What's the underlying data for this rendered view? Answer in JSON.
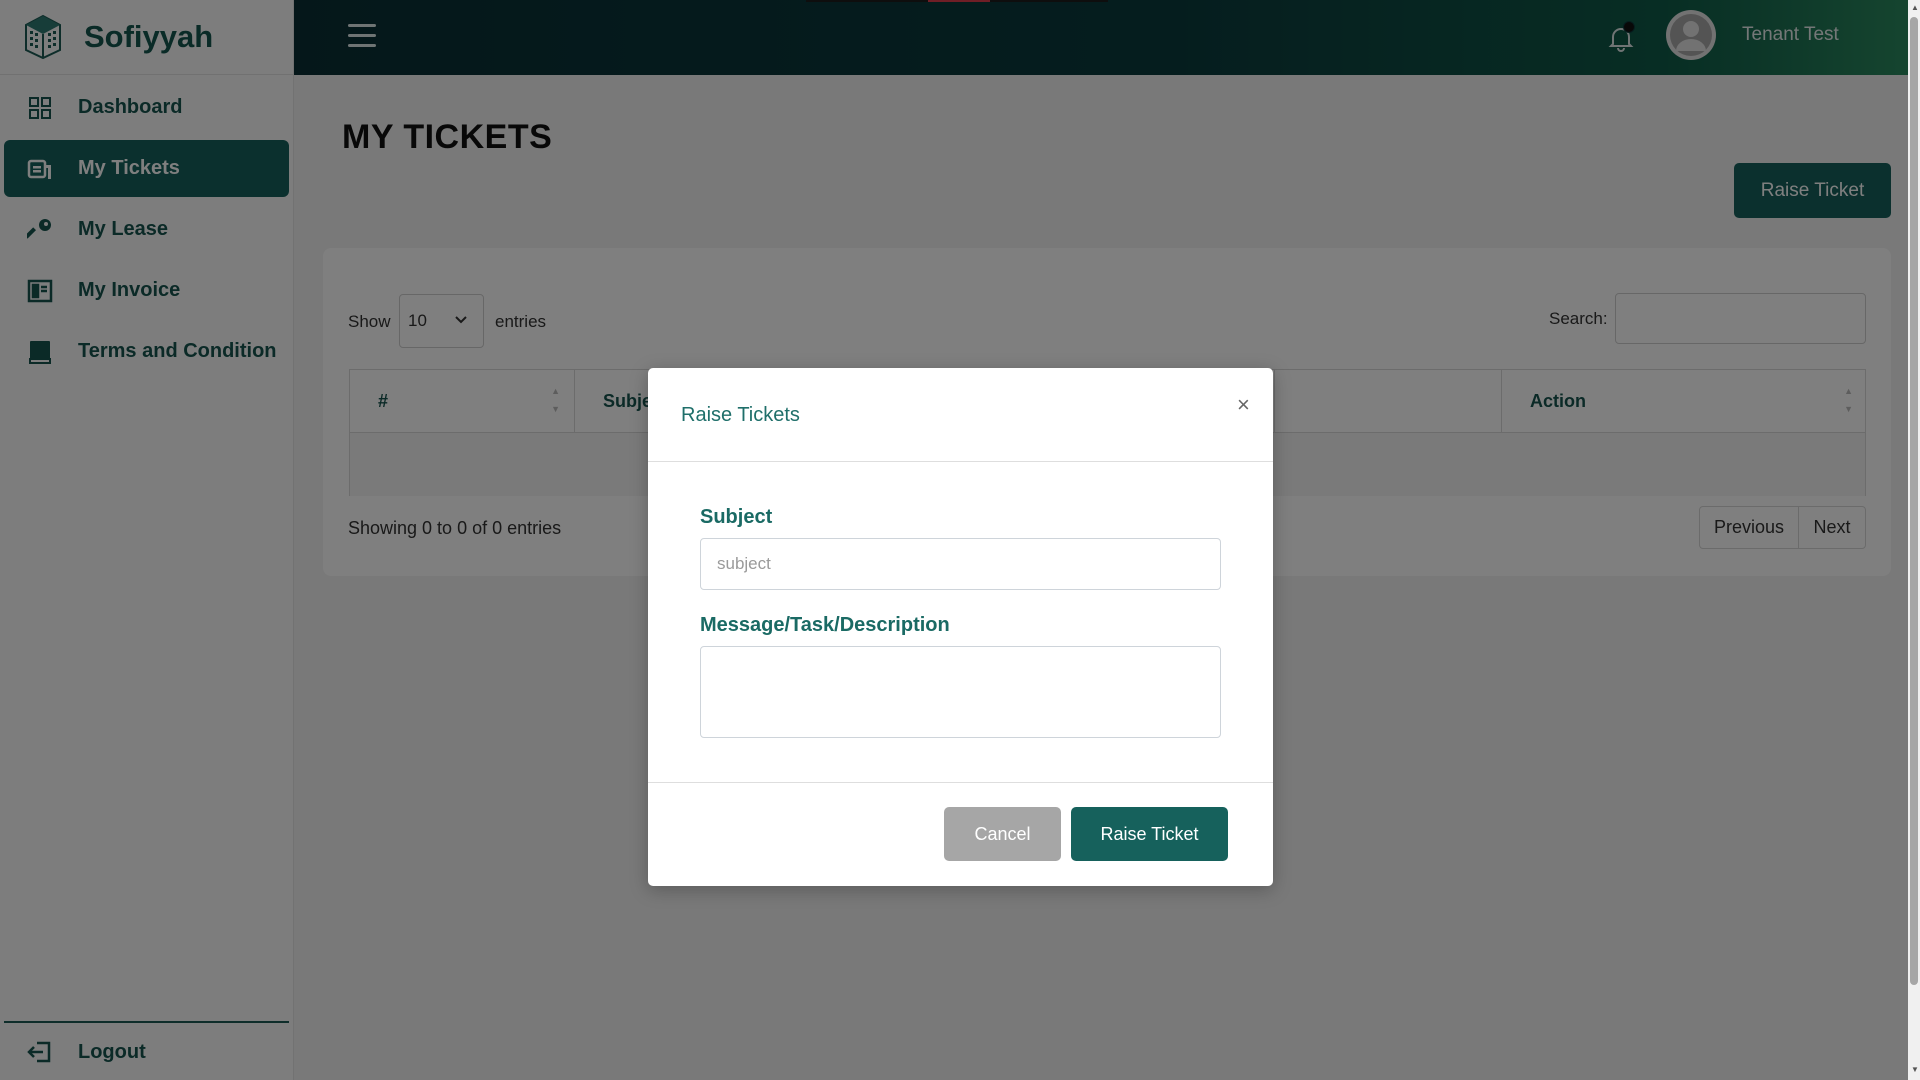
{
  "brand": {
    "name": "Sofiyyah",
    "icon": "building-icon"
  },
  "sidebar": {
    "items": [
      {
        "label": "Dashboard",
        "icon": "grid-icon",
        "active": false
      },
      {
        "label": "My Tickets",
        "icon": "ticket-icon",
        "active": true
      },
      {
        "label": "My Lease",
        "icon": "key-icon",
        "active": false
      },
      {
        "label": "My Invoice",
        "icon": "invoice-icon",
        "active": false
      },
      {
        "label": "Terms and Condition",
        "icon": "book-icon",
        "active": false
      }
    ],
    "logout_label": "Logout"
  },
  "header": {
    "user_name": "Tenant Test",
    "icons": [
      "hamburger-icon",
      "bell-icon",
      "avatar-icon"
    ]
  },
  "page": {
    "title": "MY TICKETS",
    "raise_button": "Raise Ticket"
  },
  "table": {
    "show_label": "Show",
    "entries_value": "10",
    "entries_label": "entries",
    "search_label": "Search:",
    "columns": [
      "#",
      "Subject",
      "",
      "Action"
    ],
    "showing_text": "Showing 0 to 0 of 0 entries",
    "prev_label": "Previous",
    "next_label": "Next"
  },
  "modal": {
    "title": "Raise Tickets",
    "close_symbol": "×",
    "subject_label": "Subject",
    "subject_placeholder": "subject",
    "message_label": "Message/Task/Description",
    "cancel_label": "Cancel",
    "submit_label": "Raise Ticket"
  },
  "colors": {
    "primary": "#16615c",
    "sidebar_text": "#16544f",
    "cancel": "#a6a6a6",
    "header_start": "#0a2f35",
    "header_end": "#2b8a5f"
  }
}
